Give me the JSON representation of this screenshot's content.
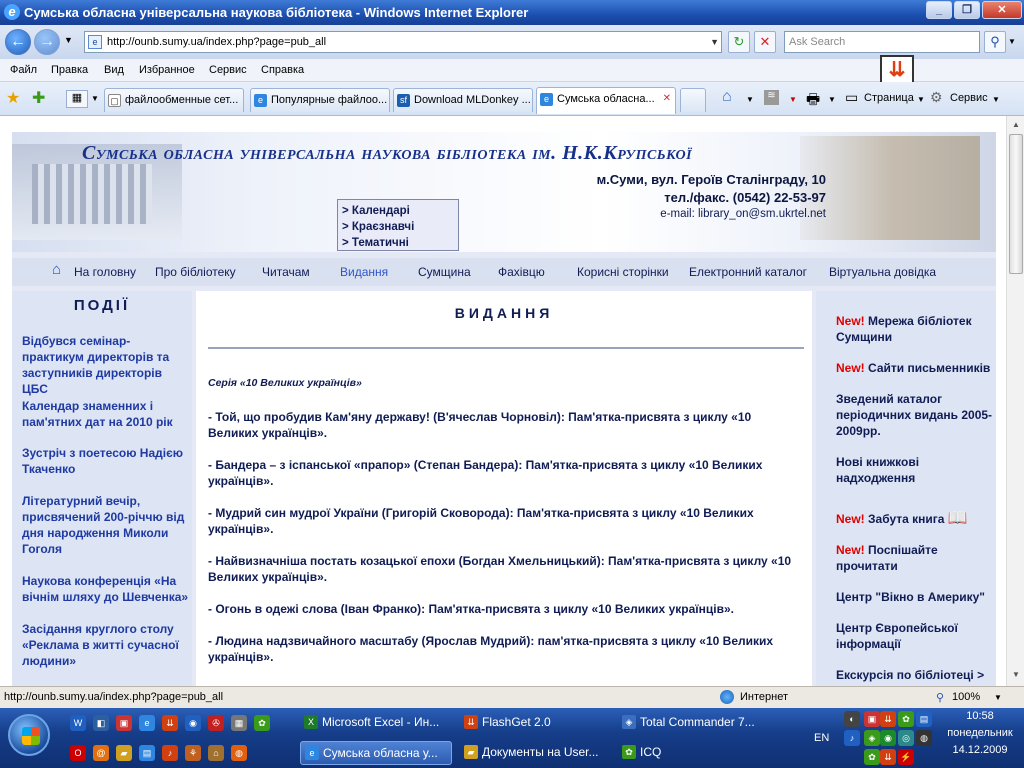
{
  "window": {
    "title": "Сумська обласна універсальна наукова бібліотека - Windows Internet Explorer",
    "min": "_",
    "max": "❐",
    "close": "✕"
  },
  "toolbar": {
    "address": "http://ounb.sumy.ua/index.php?page=pub_all",
    "search_placeholder": "Ask Search"
  },
  "menu": [
    "Файл",
    "Правка",
    "Вид",
    "Избранное",
    "Сервис",
    "Справка"
  ],
  "tabs": [
    {
      "label": "файлообменные сет..."
    },
    {
      "label": "Популярные файлоо..."
    },
    {
      "label": "Download MLDonkey ..."
    },
    {
      "label": "Сумська обласна..."
    }
  ],
  "cmdbar": {
    "page": "Страница",
    "service": "Сервис"
  },
  "page": {
    "library_title": "Сумська обласна універсальна наукова бібліотека ім. Н.К.Крупської",
    "address_line": "м.Суми, вул. Героїв Сталінграду, 10",
    "phone": "тел./факс. (0542) 22-53-97",
    "email": "e-mail: library_on@sm.ukrtel.net",
    "submenu": [
      "> Календарі",
      "> Краєзнавчі",
      "> Тематичні"
    ],
    "nav": [
      "На головну",
      "Про бібліотеку",
      "Читачам",
      "Видання",
      "Сумщина",
      "Фахівцю",
      "Корисні сторінки",
      "Електронний каталог",
      "Віртуальна довідка"
    ],
    "left_heading": "ПОДІЇ",
    "events": [
      "Відбувся семінар-практикум директорів та заступників директорів ЦБС",
      "Календар знаменних і пам'ятних дат на 2010 рік",
      "Зустріч з поетесою Надією Ткаченко",
      "Літературний вечір, присвячений 200-річчю від дня народження Миколи Гоголя",
      "Наукова конференція «На вічнім шляху до Шевченка»",
      "Засідання круглого столу «Реклама в житті сучасної людини»"
    ],
    "main_heading": "ВИДАННЯ",
    "series": "Серія «10 Великих українців»",
    "items": [
      "- Той, що пробудив Кам'яну державу! (В'ячеслав Чорновіл): Пам'ятка-присвята з циклу «10 Великих українців».",
      "- Бандера – з іспанської «прапор» (Степан Бандера): Пам'ятка-присвята з циклу «10 Великих українців».",
      "- Мудрий син мудрої України (Григорій Сковорода): Пам'ятка-присвята з циклу «10 Великих українців».",
      "- Найвизначніша постать козацької епохи (Богдан Хмельницький): Пам'ятка-присвята з циклу «10 Великих українців».",
      "- Огонь в одежі слова (Іван Франко): Пам'ятка-присвята з циклу «10 Великих українців».",
      "- Людина надзвичайного масштабу (Ярослав Мудрий): пам'ятка-присвята з циклу «10 Великих українців»."
    ],
    "new_label": "New!",
    "right_links": [
      {
        "new": true,
        "text": "Мережа бібліотек Сумщини"
      },
      {
        "new": true,
        "text": "Сайти письменників"
      },
      {
        "new": false,
        "text": "Зведений каталог періодичних видань 2005-2009рр."
      },
      {
        "new": false,
        "text": "Нові книжкові надходження"
      },
      {
        "new": true,
        "text": "Забута книга"
      },
      {
        "new": true,
        "text": "Поспішайте прочитати"
      },
      {
        "new": false,
        "text": "Центр \"Вікно в Америку\""
      },
      {
        "new": false,
        "text": "Центр Європейської інформації"
      },
      {
        "new": false,
        "text": "Екскурсія по бібліотеці >"
      }
    ]
  },
  "status": {
    "url": "http://ounb.sumy.ua/index.php?page=pub_all",
    "zone": "Интернет",
    "zoom": "100%"
  },
  "taskbar": {
    "buttons": [
      {
        "label": "Microsoft Excel - Ин..."
      },
      {
        "label": "FlashGet 2.0"
      },
      {
        "label": "Total Commander 7..."
      },
      {
        "label": "Сумська обласна у..."
      },
      {
        "label": "Документы на User..."
      },
      {
        "label": "ICQ"
      }
    ],
    "lang": "EN",
    "time": "10:58",
    "day": "понедельник",
    "date": "14.12.2009"
  }
}
